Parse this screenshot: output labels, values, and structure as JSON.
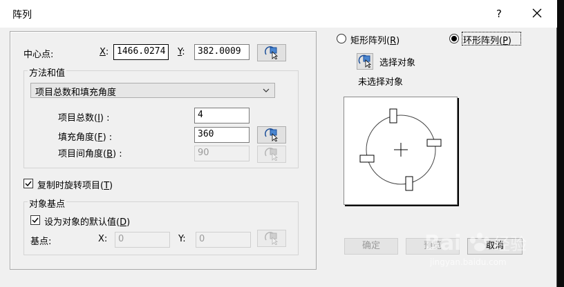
{
  "window": {
    "title": "阵列",
    "help": "?"
  },
  "center": {
    "label": "中心点:",
    "x_label": "X",
    "x_sep": ":",
    "x_value": "1466.0274",
    "y_label": "Y",
    "y_sep": ":",
    "y_value": "382.0009"
  },
  "method": {
    "group_label": "方法和值",
    "select_value": "项目总数和填充角度",
    "total": {
      "label": "项目总数(",
      "key": "I",
      "suffix": ") :",
      "value": "4"
    },
    "fill_angle": {
      "label": "填充角度(",
      "key": "F",
      "suffix": ") :",
      "value": "360"
    },
    "between_angle": {
      "label": "项目间角度(",
      "key": "B",
      "suffix": ") :",
      "value": "90"
    }
  },
  "rotate_items": {
    "label": "复制时旋转项目(",
    "key": "T",
    "suffix": ")",
    "checked": true
  },
  "base_point": {
    "group_label": "对象基点",
    "default_checkbox": {
      "label": "设为对象的默认值(",
      "key": "D",
      "suffix": ")",
      "checked": true
    },
    "label": "基点:",
    "x_label": "X:",
    "x_value": "0",
    "y_label": "Y:",
    "y_value": "0"
  },
  "array_type": {
    "rect": {
      "label": "矩形阵列(",
      "key": "R",
      "suffix": ")",
      "selected": false
    },
    "polar": {
      "label": "环形阵列(",
      "key": "P",
      "suffix": ")",
      "selected": true
    }
  },
  "select_objects": {
    "button_label": "选择对象",
    "status": "未选择对象"
  },
  "buttons": {
    "ok": "确定",
    "preview": "预览",
    "cancel": "取消"
  },
  "watermark": {
    "brand": "Bai",
    "brand2": "经验",
    "url": "jingyan.baidu.com"
  },
  "colors": {
    "dialog_bg": "#f0f0f0",
    "titlebar_bg": "#ffffff",
    "outer_bg": "#0b0b0b",
    "disabled_text": "#9a9a9a"
  }
}
